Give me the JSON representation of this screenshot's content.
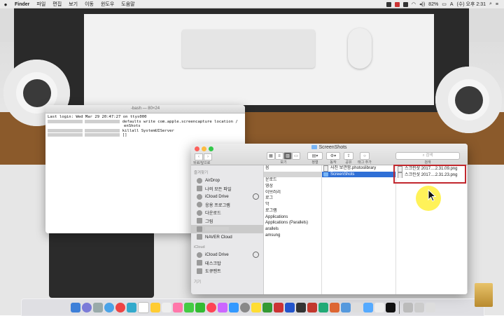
{
  "menubar": {
    "app": "Finder",
    "items": [
      "파일",
      "편집",
      "보기",
      "이동",
      "윈도우",
      "도움말"
    ],
    "battery": "82%",
    "clock": "(수) 오후 2:31",
    "input_method": "A"
  },
  "terminal": {
    "title": "-bash — 80×24",
    "lines": [
      "Last login: Wed Mar 29 20:47:27 on ttys000",
      "defaults write com.apple.screencapture location /",
      "enShots",
      "killall SystemUIServer",
      "[]"
    ]
  },
  "finder": {
    "title": "ScreenShots",
    "toolbar": {
      "back_label": "뒤로/앞으로",
      "view_label": "보기",
      "arrange_label": "정렬",
      "action_label": "동작",
      "share_label": "공유",
      "tag_label": "태그 추가",
      "search_placeholder": "검색",
      "search_label": "검색"
    },
    "sidebar": {
      "favorites_header": "즐겨찾기",
      "favorites": [
        "AirDrop",
        "나의 모든 파일",
        "iCloud Drive",
        "응용 프로그램",
        "다운로드",
        "그림",
        "",
        "NAVER Cloud"
      ],
      "icloud_header": "iCloud",
      "icloud": [
        "iCloud Drive",
        "데스크탑",
        "도큐멘트"
      ],
      "devices_header": "기기"
    },
    "column1": [
      "음",
      "",
      "운로드",
      "영상",
      "이브러리",
      "로그",
      "악",
      "로그램",
      "Applications",
      "Applications (Parallels)",
      "arallels",
      "amsung"
    ],
    "column2": [
      "사진 보관함.photoslibrary",
      "ScreenShots"
    ],
    "column3": [
      "스크린샷 2017....2.31.09.png",
      "스크린샷 2017....2.31.23.png"
    ]
  },
  "colors": {
    "selection": "#2f6fd6",
    "highlight_box": "#c1272d",
    "cursor_halo": "#fff03c"
  }
}
